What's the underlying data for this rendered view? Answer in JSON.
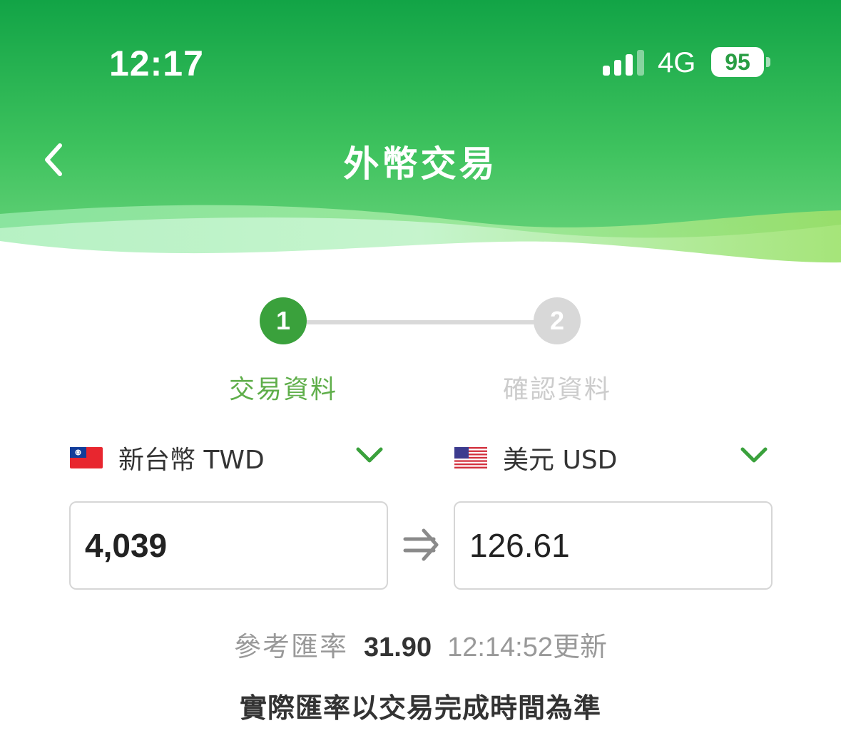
{
  "status_bar": {
    "time": "12:17",
    "network": "4G",
    "battery": "95"
  },
  "nav": {
    "title": "外幣交易",
    "back_icon": "chevron-left-icon"
  },
  "stepper": {
    "steps": [
      {
        "number": "1",
        "label": "交易資料",
        "active": true
      },
      {
        "number": "2",
        "label": "確認資料",
        "active": false
      }
    ]
  },
  "exchange": {
    "from": {
      "currency": "新台幣 TWD",
      "flag": "taiwan-flag-icon",
      "amount": "4,039"
    },
    "to": {
      "currency": "美元 USD",
      "flag": "usa-flag-icon",
      "amount": "126.61"
    }
  },
  "rate": {
    "label": "參考匯率",
    "value": "31.90",
    "updated_time": "12:14:52",
    "updated_suffix": "更新"
  },
  "note": "實際匯率以交易完成時間為準",
  "colors": {
    "header_green": "#16a74a",
    "accent_green": "#3aa13c",
    "inactive_gray": "#d8d8d8"
  }
}
